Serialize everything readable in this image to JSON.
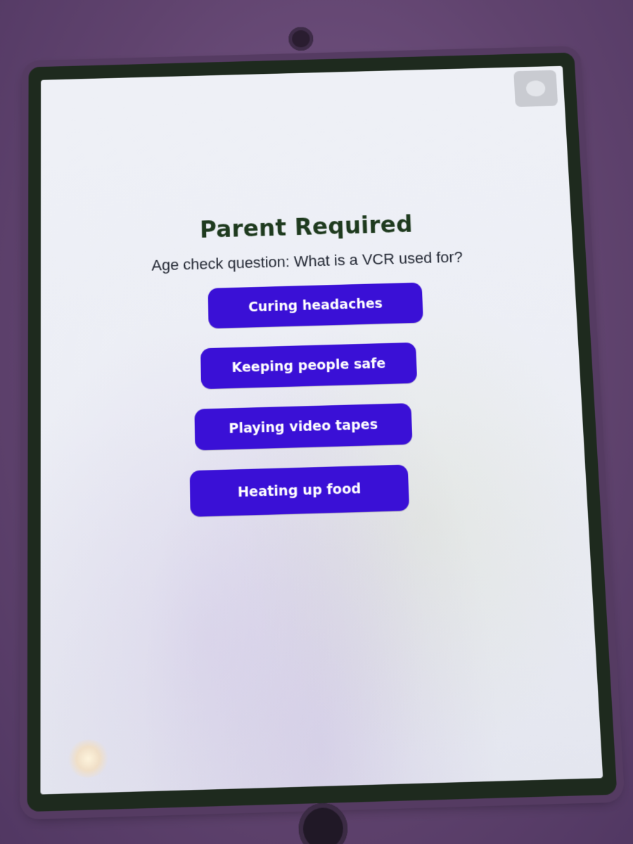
{
  "screen": {
    "title": "Parent Required",
    "question": "Age check question: What is a VCR used for?",
    "answers": [
      {
        "label": "Curing headaches"
      },
      {
        "label": "Keeping people safe"
      },
      {
        "label": "Playing video tapes"
      },
      {
        "label": "Heating up food"
      }
    ]
  },
  "colors": {
    "title_color": "#1e3a1e",
    "button_color": "#3a10d6",
    "button_text": "#ffffff",
    "screen_background": "#eceef5",
    "case_color": "#6d4e7c"
  },
  "icons": {
    "corner_button": "assistive-touch-icon",
    "home_button": "home-button-icon"
  }
}
